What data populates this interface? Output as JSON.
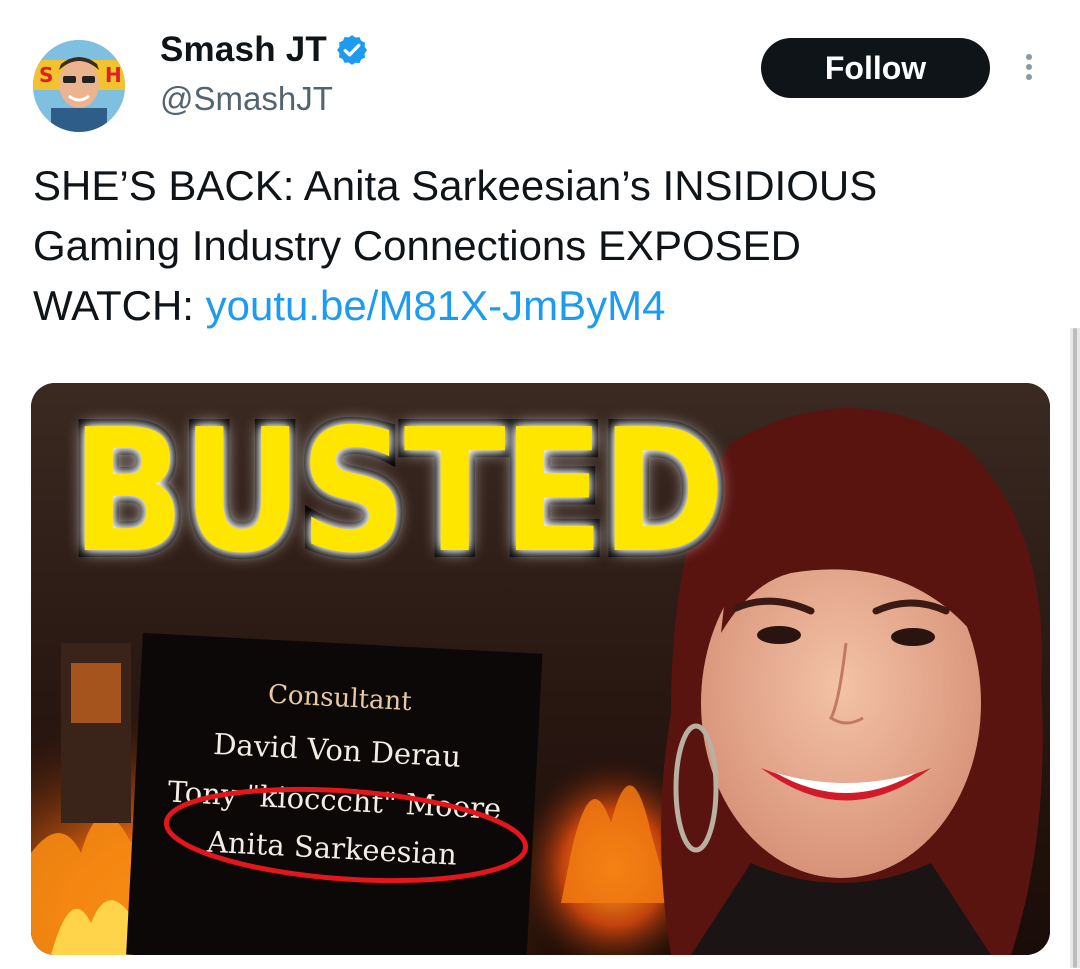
{
  "author": {
    "display_name": "Smash JT",
    "handle": "@SmashJT",
    "avatar": "avatar",
    "verified_icon": "verified-badge-icon"
  },
  "follow_label": "Follow",
  "more_icon": "more-vertical-icon",
  "tweet": {
    "line1": "SHE’S BACK: Anita Sarkeesian’s INSIDIOUS",
    "line2": "Gaming Industry Connections EXPOSED",
    "line3_prefix": "WATCH: ",
    "link": "youtu.be/M81X-JmByM4"
  },
  "media": {
    "headline": "BUSTED",
    "credits": [
      "Consultant",
      "David Von Derau",
      "Tony \"kiocccht\" Moore",
      "Anita Sarkeesian"
    ]
  },
  "colors": {
    "accent": "#1d9bf0",
    "button_bg": "#0f1419",
    "busted_yellow": "#ffe600",
    "circle_red": "#e3161b"
  }
}
